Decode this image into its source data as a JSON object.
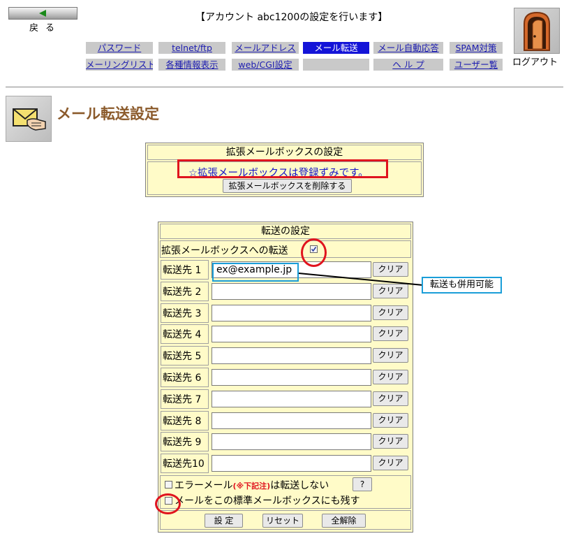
{
  "header": {
    "back_label": "戻る",
    "title": "【アカウント abc1200の設定を行います】",
    "logout_label": "ログアウト"
  },
  "nav": {
    "row1": [
      "パスワード",
      "telnet/ftp",
      "メールアドレス",
      "メール転送",
      "メール自動応答",
      "SPAM対策"
    ],
    "row2": [
      "メーリングリスト",
      "各種情報表示",
      "web/CGI設定",
      "",
      "ヘ ル プ",
      "ユーザー覧"
    ],
    "active": "メール転送"
  },
  "page": {
    "title": "メール転送設定"
  },
  "extended_mailbox": {
    "heading": "拡張メールボックスの設定",
    "status": "☆拡張メールボックスは登録ずみです。",
    "delete_button": "拡張メールボックスを削除する"
  },
  "forward": {
    "heading": "転送の設定",
    "to_ext_label": "拡張メールボックスへの転送",
    "to_ext_checked": true,
    "rows": [
      {
        "label": "転送先 1",
        "value": "ex@example.jp"
      },
      {
        "label": "転送先 2",
        "value": ""
      },
      {
        "label": "転送先 3",
        "value": ""
      },
      {
        "label": "転送先 4",
        "value": ""
      },
      {
        "label": "転送先 5",
        "value": ""
      },
      {
        "label": "転送先 6",
        "value": ""
      },
      {
        "label": "転送先 7",
        "value": ""
      },
      {
        "label": "転送先 8",
        "value": ""
      },
      {
        "label": "転送先 9",
        "value": ""
      },
      {
        "label": "転送先10",
        "value": ""
      }
    ],
    "clear_label": "クリア",
    "error_prefix": "エラーメール",
    "error_note": "(※下記注)",
    "error_suffix": "は転送しない",
    "help_label": "?",
    "keep_label": "メールをこの標準メールボックスにも残す",
    "set_button": "設 定",
    "reset_button": "リセット",
    "release_button": "全解除"
  },
  "annotation": {
    "callout": "転送も併用可能"
  },
  "colors": {
    "title": "#8b5a2b",
    "panel": "#fffbc8",
    "nav_active": "#1414d8",
    "link": "#1c1cb0",
    "annotation_red": "#e0141e",
    "annotation_blue": "#1a9ed8"
  }
}
